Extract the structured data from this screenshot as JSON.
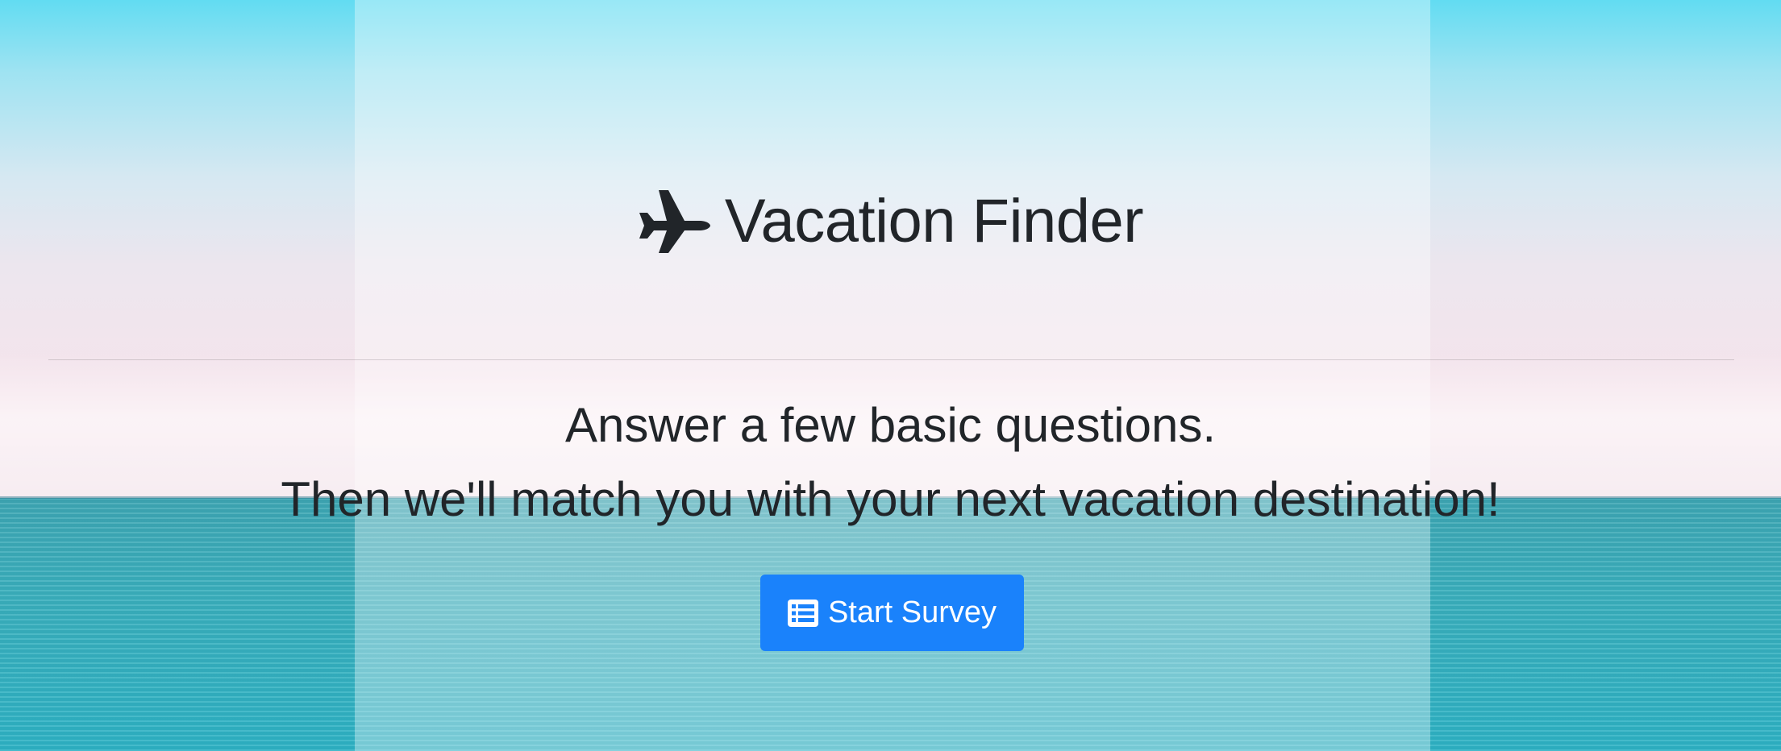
{
  "header": {
    "title": "Vacation Finder",
    "icon": "plane-icon"
  },
  "lead": {
    "line1": "Answer a few basic questions.",
    "line2": "Then we'll match you with your next vacation destination!"
  },
  "cta": {
    "label": "Start Survey",
    "icon": "list-icon",
    "color": "#1a82fb"
  },
  "colors": {
    "text": "#212529",
    "sky_top": "#62dcf2",
    "sky_bottom": "#f4e6ec",
    "sea": "#3bb0bd"
  }
}
